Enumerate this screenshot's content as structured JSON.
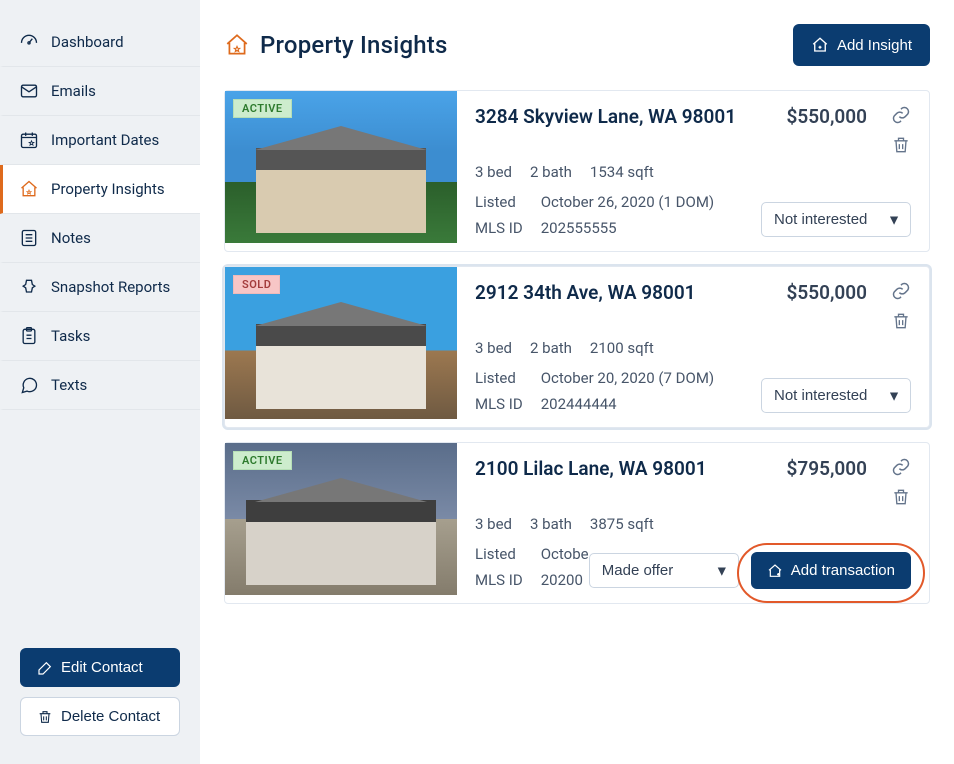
{
  "sidebar": {
    "items": [
      {
        "label": "Dashboard",
        "icon": "gauge-icon"
      },
      {
        "label": "Emails",
        "icon": "mail-icon"
      },
      {
        "label": "Important Dates",
        "icon": "calendar-star-icon"
      },
      {
        "label": "Property Insights",
        "icon": "house-star-icon",
        "active": true
      },
      {
        "label": "Notes",
        "icon": "notes-icon"
      },
      {
        "label": "Snapshot Reports",
        "icon": "pinned-icon"
      },
      {
        "label": "Tasks",
        "icon": "clipboard-icon"
      },
      {
        "label": "Texts",
        "icon": "chat-icon"
      }
    ],
    "edit_contact_label": "Edit Contact",
    "delete_contact_label": "Delete Contact"
  },
  "header": {
    "title": "Property Insights",
    "add_button_label": "Add Insight"
  },
  "status_options": [
    "Not interested",
    "Made offer"
  ],
  "add_transaction_label": "Add transaction",
  "cards": [
    {
      "badge": "ACTIVE",
      "badge_kind": "active",
      "address": "3284 Skyview Lane, WA 98001",
      "price": "$550,000",
      "beds": "3 bed",
      "baths": "2 bath",
      "sqft": "1534 sqft",
      "listed_label": "Listed",
      "listed_value": "October 26, 2020 (1 DOM)",
      "mls_label": "MLS ID",
      "mls_value": "202555555",
      "status": "Not interested"
    },
    {
      "badge": "SOLD",
      "badge_kind": "sold",
      "address": "2912 34th Ave, WA 98001",
      "price": "$550,000",
      "beds": "3 bed",
      "baths": "2 bath",
      "sqft": "2100 sqft",
      "listed_label": "Listed",
      "listed_value": "October 20, 2020 (7 DOM)",
      "mls_label": "MLS ID",
      "mls_value": "202444444",
      "status": "Not interested"
    },
    {
      "badge": "ACTIVE",
      "badge_kind": "active",
      "address": "2100 Lilac Lane, WA 98001",
      "price": "$795,000",
      "beds": "3 bed",
      "baths": "3 bath",
      "sqft": "3875 sqft",
      "listed_label": "Listed",
      "listed_value_partial": "Octobe",
      "mls_label": "MLS ID",
      "mls_value_partial": "20200",
      "status": "Made offer"
    }
  ]
}
